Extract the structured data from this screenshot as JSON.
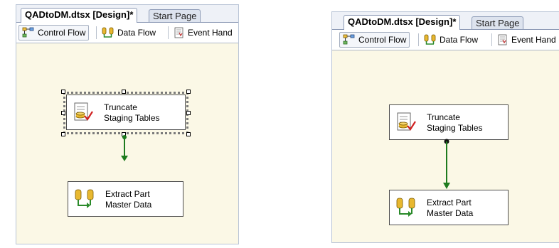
{
  "colors": {
    "canvas": "#fbf8e6",
    "connector": "#1e7b1e",
    "tab_border": "#8d9bb6"
  },
  "panels": [
    {
      "document_tabs": [
        {
          "label": "QADtoDM.dtsx [Design]*",
          "active": true
        },
        {
          "label": "Start Page",
          "active": false
        }
      ],
      "designer_tabs": [
        {
          "label": "Control Flow",
          "icon": "control-flow-icon",
          "active": true
        },
        {
          "label": "Data Flow",
          "icon": "data-flow-icon",
          "active": false
        },
        {
          "label": "Event Hand",
          "icon": "event-handlers-icon",
          "active": false
        }
      ],
      "tasks": [
        {
          "line1": "Truncate",
          "line2": "Staging Tables",
          "icon": "sql-task-icon",
          "selected": true
        },
        {
          "line1": "Extract Part",
          "line2": "Master Data",
          "icon": "data-flow-task-icon",
          "selected": false
        }
      ]
    },
    {
      "document_tabs": [
        {
          "label": "QADtoDM.dtsx [Design]*",
          "active": true
        },
        {
          "label": "Start Page",
          "active": false
        }
      ],
      "designer_tabs": [
        {
          "label": "Control Flow",
          "icon": "control-flow-icon",
          "active": true
        },
        {
          "label": "Data Flow",
          "icon": "data-flow-icon",
          "active": false
        },
        {
          "label": "Event Hand",
          "icon": "event-handlers-icon",
          "active": false
        }
      ],
      "tasks": [
        {
          "line1": "Truncate",
          "line2": "Staging Tables",
          "icon": "sql-task-icon",
          "selected": false
        },
        {
          "line1": "Extract Part",
          "line2": "Master Data",
          "icon": "data-flow-task-icon",
          "selected": false
        }
      ]
    }
  ]
}
